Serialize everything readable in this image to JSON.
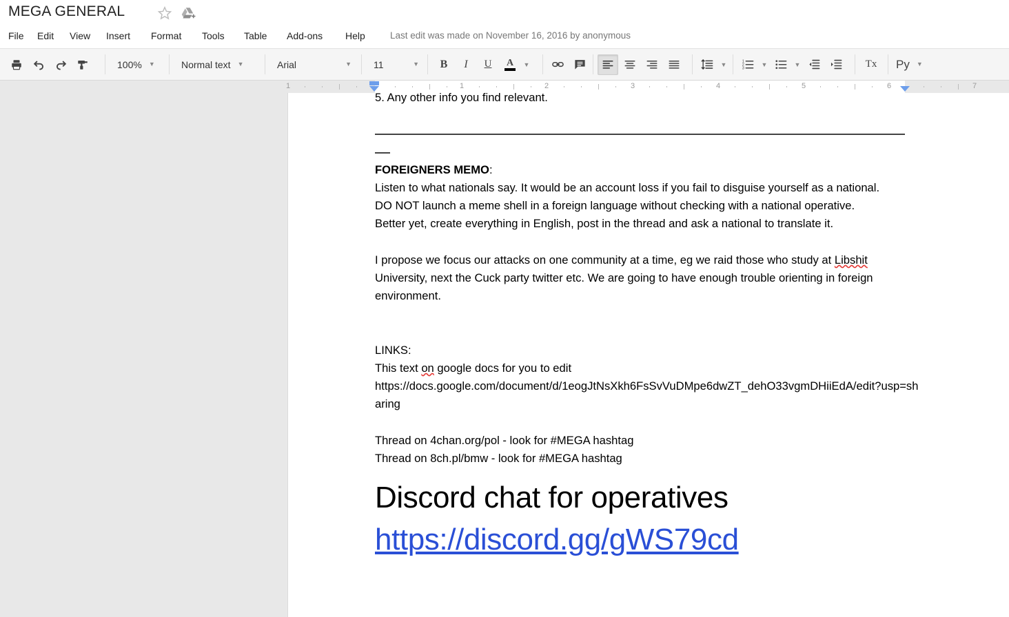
{
  "window": {
    "title": "MEGA GENERAL",
    "star_icon": "star-icon",
    "drive_icon": "drive-add-icon"
  },
  "menu": {
    "items": [
      "File",
      "Edit",
      "View",
      "Insert",
      "Format",
      "Tools",
      "Table",
      "Add-ons",
      "Help"
    ],
    "last_edit": "Last edit was made on November 16, 2016 by anonymous"
  },
  "toolbar": {
    "print_icon": "print-icon",
    "undo_icon": "undo-icon",
    "redo_icon": "redo-icon",
    "paint_format_icon": "paint-format-icon",
    "zoom_value": "100%",
    "style_value": "Normal text",
    "font_value": "Arial",
    "size_value": "11",
    "bold_label": "B",
    "italic_label": "I",
    "underline_label": "U",
    "text_color_label": "A",
    "text_color_hex": "#000000",
    "link_icon": "insert-link-icon",
    "comment_icon": "insert-comment-icon",
    "align_left_icon": "align-left-icon",
    "align_center_icon": "align-center-icon",
    "align_right_icon": "align-right-icon",
    "align_justify_icon": "align-justify-icon",
    "line_spacing_icon": "line-spacing-icon",
    "numbered_list_icon": "numbered-list-icon",
    "bulleted_list_icon": "bulleted-list-icon",
    "decrease_indent_icon": "decrease-indent-icon",
    "increase_indent_icon": "increase-indent-icon",
    "clear_formatting_label": "Tx",
    "input_tools_label": "Py",
    "active_alignment": "left"
  },
  "ruler": {
    "labels": [
      "1",
      "1",
      "2",
      "3",
      "4",
      "5",
      "6",
      "7"
    ],
    "left_indent_marker": "left-indent-marker",
    "right_indent_marker": "right-indent-marker"
  },
  "document": {
    "clipped_line": "5. Any other info you find relevant.",
    "memo_heading": "FOREIGNERS MEMO",
    "memo_heading_colon": ":",
    "memo_lines": [
      "Listen to what nationals say. It would be an account loss if you fail to disguise yourself as a national.",
      "DO NOT launch a meme shell in a foreign language without checking with a national operative.",
      "Better yet, create everything in English, post in the thread and ask a national to translate it."
    ],
    "proposal_part1": "I propose we focus our attacks on one community at a time, eg we raid those who study at ",
    "proposal_misspelled": "Libshit",
    "proposal_part2": " University, next the Cuck party twitter etc. We are going to have enough trouble orienting in foreign environment.",
    "links_heading": "LINKS:",
    "links_text_part1": "This text ",
    "links_text_misspelled": "on",
    "links_text_part2": " google docs for you to edit",
    "docs_url": "https://docs.google.com/document/d/1eogJtNsXkh6FsSvVuDMpe6dwZT_dehO33vgmDHiiEdA/edit?usp=sharing",
    "thread_4chan": "Thread on 4chan.org/pol - look for #MEGA hashtag",
    "thread_8ch": "Thread on 8ch.pl/bmw - look for #MEGA hashtag",
    "discord_heading": "Discord chat for operatives",
    "discord_url": "https://discord.gg/gWS79cd",
    "link_color_hex": "#2a4fd6"
  }
}
